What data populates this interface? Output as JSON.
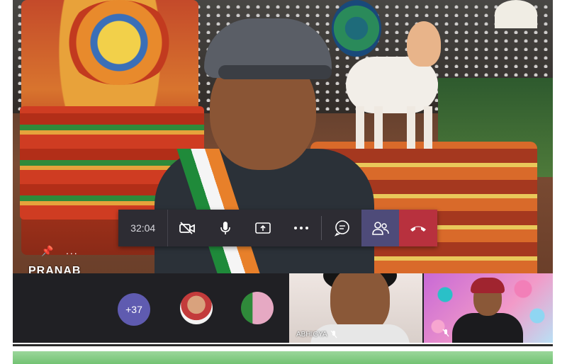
{
  "call": {
    "timer": "32:04",
    "presenter_name": "PRANAB"
  },
  "controls": {
    "camera": "camera-off-icon",
    "mic": "microphone-icon",
    "share": "share-screen-icon",
    "more": "more-options-icon",
    "chat": "chat-icon",
    "people": "participants-icon",
    "hangup": "hang-up-icon"
  },
  "participants": {
    "more_count": "+37",
    "tiles": [
      {
        "name": "ABHIGYA",
        "mic": "mic-off-icon"
      },
      {
        "name": "",
        "mic": "mic-off-icon"
      }
    ]
  },
  "colors": {
    "control_bar": "#2d2c33",
    "people_active": "#4e4b79",
    "hangup": "#b8313e",
    "more_badge": "#5f5bb0",
    "strip_bg": "#202024"
  }
}
